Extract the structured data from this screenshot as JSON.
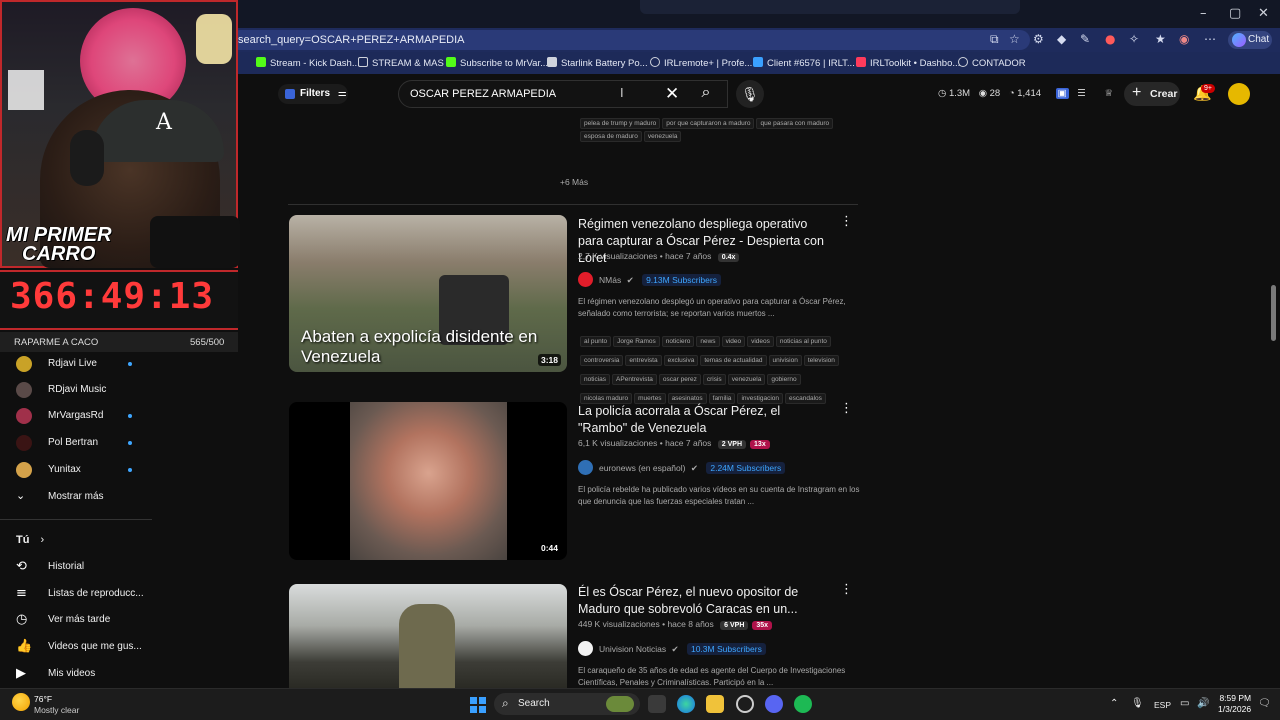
{
  "browser": {
    "url": "search_query=OSCAR+PEREZ+ARMAPEDIA",
    "chat_label": "Chat",
    "bookmarks": [
      {
        "label": "Stream - Kick Dash...",
        "color": "#53fc18"
      },
      {
        "label": "STREAM & MAS",
        "color": "#cfd3dc"
      },
      {
        "label": "Subscribe to MrVar...",
        "color": "#53fc18"
      },
      {
        "label": "Starlink Battery Po...",
        "color": "#cfd3dc"
      },
      {
        "label": "IRLremote+ | Profe...",
        "color": "#cfd3dc"
      },
      {
        "label": "Client #6576 | IRLT...",
        "color": "#3aa0ff"
      },
      {
        "label": "IRLToolkit • Dashbo...",
        "color": "#ff3b5c"
      },
      {
        "label": "CONTADOR",
        "color": "#cfd3dc"
      }
    ]
  },
  "youtube": {
    "filters_label": "Filters",
    "search_query": "OSCAR PEREZ ARMAPEDIA",
    "stats": {
      "views": "1.3M",
      "count2": "28",
      "count3": "1,414"
    },
    "create_label": "Crear",
    "notif_badge": "9+"
  },
  "overlay": {
    "title_line1": "MI PRIMER",
    "title_line2": "CARRO",
    "timer": "366:49:13",
    "goal_label": "RAPARME A CACO",
    "goal_count": "565/500",
    "goal_progress": 1.0
  },
  "sidebar": {
    "subscriptions": [
      {
        "label": "Rdjavi Live",
        "color": "#c9a227",
        "live": true
      },
      {
        "label": "RDjavi Music",
        "color": "#5a4a48",
        "live": false
      },
      {
        "label": "MrVargasRd",
        "color": "#a0304a",
        "live": true
      },
      {
        "label": "Pol Bertran",
        "color": "#3a1414",
        "live": true
      },
      {
        "label": "Yunitax",
        "color": "#d4a24a",
        "live": true
      }
    ],
    "show_more": "Mostrar más",
    "you_label": "Tú",
    "you_items": [
      {
        "label": "Historial",
        "icon": "history-icon",
        "glyph": "⟲"
      },
      {
        "label": "Listas de reproducc...",
        "icon": "playlist-icon",
        "glyph": "≡"
      },
      {
        "label": "Ver más tarde",
        "icon": "clock-icon",
        "glyph": "◷"
      },
      {
        "label": "Videos que me gus...",
        "icon": "thumbs-up-icon",
        "glyph": "👍"
      },
      {
        "label": "Mis videos",
        "icon": "my-videos-icon",
        "glyph": "▶"
      }
    ]
  },
  "results": {
    "top_chips_row1": [
      "pelea de trump y maduro",
      "por que capturaron a maduro",
      "que pasara con maduro"
    ],
    "top_chips_row2": [
      "esposa de maduro",
      "venezuela"
    ],
    "more_label": "+6 Más",
    "videos": [
      {
        "title": "Régimen venezolano despliega operativo para capturar a Óscar Pérez - Despierta con Loret",
        "views": "2,7 K visualizaciones",
        "age": "hace 7 años",
        "badges": [
          {
            "text": "0.4x",
            "color": "#333333"
          }
        ],
        "channel": "NMás",
        "channel_color": "#e11d2a",
        "subs": "9.13M Subscribers",
        "description": "El régimen venezolano desplegó un operativo para capturar a Óscar Pérez, señalado como terrorista; se reportan varios muertos ...",
        "duration": "3:18",
        "thumb_caption": "Abaten a expolicía disidente en Venezuela",
        "tags": [
          [
            "al punto",
            "Jorge Ramos",
            "noticiero",
            "news",
            "video",
            "videos",
            "noticias al punto"
          ],
          [
            "controversia",
            "entrevista",
            "exclusiva",
            "temas de actualidad",
            "univision",
            "television"
          ],
          [
            "noticias",
            "APentrevista",
            "oscar perez",
            "crisis",
            "venezuela",
            "gobierno"
          ],
          [
            "nicolas maduro",
            "muertes",
            "asesinatos",
            "familia",
            "investigacion",
            "escandalos"
          ]
        ]
      },
      {
        "title": "La policía acorrala a Óscar Pérez, el \"Rambo\" de Venezuela",
        "views": "6,1 K visualizaciones",
        "age": "hace 7 años",
        "badges": [
          {
            "text": "2 VPH",
            "color": "#333333"
          },
          {
            "text": "13x",
            "color": "#b0124a"
          }
        ],
        "channel": "euronews (en español)",
        "channel_color": "#2f6fb5",
        "subs": "2.24M Subscribers",
        "description": "El policía rebelde ha publicado varios vídeos en su cuenta de Instragram en los que denuncia que las fuerzas especiales tratan ...",
        "duration": "0:44"
      },
      {
        "title": "Él es Óscar Pérez, el nuevo opositor de Maduro que sobrevoló Caracas en un...",
        "views": "449 K visualizaciones",
        "age": "hace 8 años",
        "badges": [
          {
            "text": "6 VPH",
            "color": "#333333"
          },
          {
            "text": "35x",
            "color": "#b0124a"
          }
        ],
        "channel": "Univision Noticias",
        "channel_color": "#f2f2f2",
        "subs": "10.3M Subscribers",
        "description": "El caraqueño de 35 años de edad es agente del Cuerpo de Investigaciones Científicas, Penales y Criminalísticas. Participó en la ..."
      }
    ]
  },
  "taskbar": {
    "weather_temp": "76°F",
    "weather_desc": "Mostly clear",
    "search_label": "Search",
    "lang": "ESP",
    "time": "8:59 PM",
    "date": "1/3/2026"
  }
}
